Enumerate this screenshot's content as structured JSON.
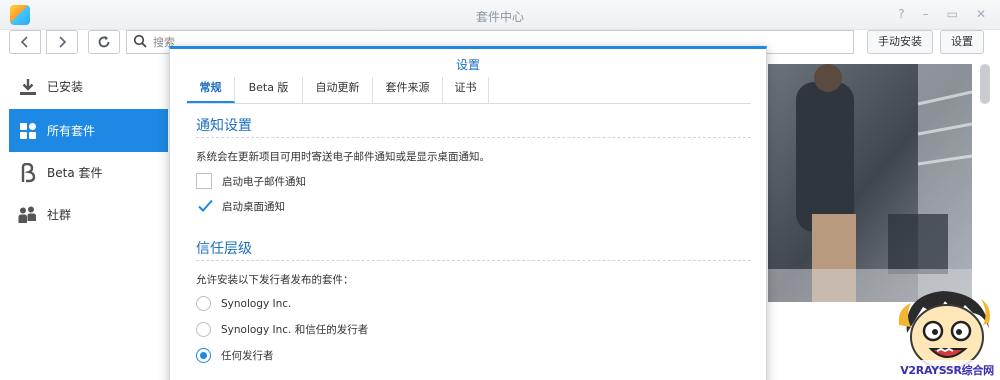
{
  "window": {
    "title": "套件中心",
    "controls": [
      "?",
      "–",
      "▭",
      "✕"
    ]
  },
  "toolbar": {
    "back_icon": "chevron-left-icon",
    "forward_icon": "chevron-right-icon",
    "refresh_icon": "refresh-icon",
    "search_placeholder": "搜索",
    "manual_install_label": "手动安装",
    "settings_label": "设置"
  },
  "sidebar": {
    "items": [
      {
        "label": "已安装",
        "icon": "download-icon",
        "active": false
      },
      {
        "label": "所有套件",
        "icon": "grid-icon",
        "active": true
      },
      {
        "label": "Beta 套件",
        "icon": "beta-icon",
        "active": false
      },
      {
        "label": "社群",
        "icon": "community-icon",
        "active": false
      }
    ]
  },
  "dialog": {
    "title": "设置",
    "tabs": [
      {
        "label": "常规",
        "active": true
      },
      {
        "label": "Beta 版",
        "active": false
      },
      {
        "label": "自动更新",
        "active": false
      },
      {
        "label": "套件来源",
        "active": false
      },
      {
        "label": "证书",
        "active": false
      }
    ],
    "notify": {
      "heading": "通知设置",
      "description": "系统会在更新项目可用时寄送电子邮件通知或是显示桌面通知。",
      "options": [
        {
          "label": "启动电子邮件通知",
          "checked": false
        },
        {
          "label": "启动桌面通知",
          "checked": true
        }
      ]
    },
    "trust": {
      "heading": "信任层级",
      "description": "允许安装以下发行者发布的套件：",
      "options": [
        {
          "label": "Synology Inc.",
          "selected": false
        },
        {
          "label": "Synology Inc. 和信任的发行者",
          "selected": false
        },
        {
          "label": "任何发行者",
          "selected": true
        }
      ]
    }
  },
  "watermark": {
    "text": "V2RAYSSR综合网"
  },
  "colors": {
    "accent": "#1e88e5",
    "heading": "#1e6fbf",
    "border": "#c8cdd4"
  }
}
